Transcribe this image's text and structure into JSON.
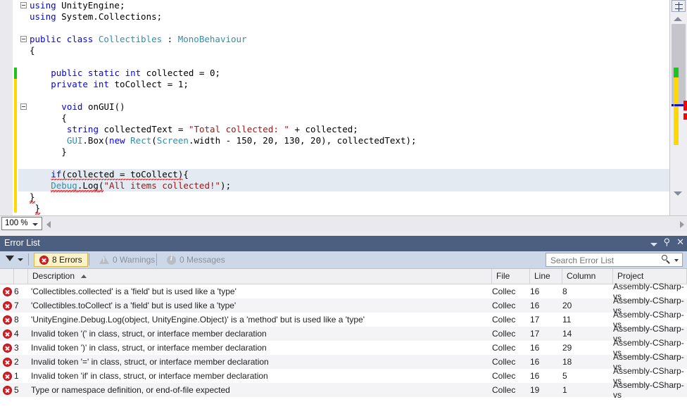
{
  "editor": {
    "zoom_level": "100 %",
    "code_lines": [
      {
        "indent": 0,
        "outline": true,
        "tokens": [
          {
            "t": "using ",
            "c": "k"
          },
          {
            "t": "UnityEngine;",
            "c": "p"
          }
        ]
      },
      {
        "indent": 0,
        "outline": false,
        "tokens": [
          {
            "t": "using ",
            "c": "k"
          },
          {
            "t": "System.Collections;",
            "c": "p"
          }
        ]
      },
      {
        "indent": 0,
        "outline": false,
        "tokens": []
      },
      {
        "indent": 0,
        "outline": true,
        "tokens": [
          {
            "t": "public ",
            "c": "k"
          },
          {
            "t": "class ",
            "c": "k"
          },
          {
            "t": "Collectibles",
            "c": "t"
          },
          {
            "t": " : ",
            "c": "p"
          },
          {
            "t": "MonoBehaviour",
            "c": "t"
          }
        ]
      },
      {
        "indent": 0,
        "outline": false,
        "tokens": [
          {
            "t": "{",
            "c": "p"
          }
        ]
      },
      {
        "indent": 0,
        "outline": false,
        "tokens": []
      },
      {
        "indent": 4,
        "outline": false,
        "tokens": [
          {
            "t": "public ",
            "c": "k"
          },
          {
            "t": "static ",
            "c": "k"
          },
          {
            "t": "int ",
            "c": "k"
          },
          {
            "t": "collected = ",
            "c": "p"
          },
          {
            "t": "0",
            "c": "p"
          },
          {
            "t": ";",
            "c": "p"
          }
        ]
      },
      {
        "indent": 4,
        "outline": false,
        "tokens": [
          {
            "t": "private ",
            "c": "k"
          },
          {
            "t": "int ",
            "c": "k"
          },
          {
            "t": "toCollect = ",
            "c": "p"
          },
          {
            "t": "1",
            "c": "p"
          },
          {
            "t": ";",
            "c": "p"
          }
        ]
      },
      {
        "indent": 0,
        "outline": false,
        "tokens": []
      },
      {
        "indent": 6,
        "outline": true,
        "tokens": [
          {
            "t": "void ",
            "c": "k"
          },
          {
            "t": "onGUI()",
            "c": "p"
          }
        ]
      },
      {
        "indent": 6,
        "outline": false,
        "tokens": [
          {
            "t": "{",
            "c": "p"
          }
        ]
      },
      {
        "indent": 6,
        "outline": false,
        "tokens": [
          {
            "t": " ",
            "c": "p"
          },
          {
            "t": "string ",
            "c": "k"
          },
          {
            "t": "collectedText = ",
            "c": "p"
          },
          {
            "t": "\"Total collected: \"",
            "c": "s"
          },
          {
            "t": " + collected;",
            "c": "p"
          }
        ]
      },
      {
        "indent": 6,
        "outline": false,
        "tokens": [
          {
            "t": " ",
            "c": "p"
          },
          {
            "t": "GUI",
            "c": "t"
          },
          {
            "t": ".Box(",
            "c": "p"
          },
          {
            "t": "new ",
            "c": "k"
          },
          {
            "t": "Rect",
            "c": "t"
          },
          {
            "t": "(",
            "c": "p"
          },
          {
            "t": "Screen",
            "c": "t"
          },
          {
            "t": ".width - 150, 20, 130, 20), collectedText);",
            "c": "p"
          }
        ]
      },
      {
        "indent": 6,
        "outline": false,
        "tokens": [
          {
            "t": "}",
            "c": "p"
          }
        ]
      },
      {
        "indent": 0,
        "outline": false,
        "tokens": []
      },
      {
        "indent": 4,
        "outline": false,
        "selected": true,
        "tokens": [
          {
            "t": "if",
            "c": "k",
            "squiggle": true
          },
          {
            "t": "(collected ",
            "c": "p",
            "squiggle": true
          },
          {
            "t": "=",
            "c": "p",
            "squiggle": true
          },
          {
            "t": " toCollect)",
            "c": "p",
            "squiggle": true
          },
          {
            "t": "{",
            "c": "p"
          }
        ]
      },
      {
        "indent": 4,
        "outline": false,
        "selected": true,
        "tokens": [
          {
            "t": "Debug",
            "c": "t",
            "squiggle": true
          },
          {
            "t": ".Log",
            "c": "p",
            "squiggle": true
          },
          {
            "t": "(",
            "c": "p",
            "squiggle": true
          },
          {
            "t": "\"All items collected!\"",
            "c": "s"
          },
          {
            "t": ");",
            "c": "p"
          }
        ]
      },
      {
        "indent": 0,
        "outline": false,
        "tokens": [
          {
            "t": "}",
            "c": "p",
            "squiggle": true
          }
        ]
      },
      {
        "indent": 1,
        "outline": false,
        "tokens": [
          {
            "t": "}",
            "c": "p",
            "squiggle": true
          }
        ]
      }
    ],
    "scrollbar": {
      "saved_change_color": "#1ec31e",
      "unsaved_change_color": "#ffd800",
      "error_marker_color": "#ff0000",
      "caret_marker_color": "#000080"
    }
  },
  "error_list": {
    "title": "Error List",
    "window_buttons": {
      "dropdown": "▾",
      "pin": "⚲",
      "close": "✕"
    },
    "filter_label": "filter-dropdown",
    "counters": [
      {
        "name": "errors",
        "label": "8 Errors",
        "icon": "error-icon",
        "active": true
      },
      {
        "name": "warnings",
        "label": "0 Warnings",
        "icon": "warning-icon",
        "active": false
      },
      {
        "name": "messages",
        "label": "0 Messages",
        "icon": "info-icon",
        "active": false
      }
    ],
    "search": {
      "placeholder": "Search Error List",
      "value": ""
    },
    "columns": [
      "",
      "",
      "Description",
      "File",
      "Line",
      "Column",
      "Project"
    ],
    "sorted_by": "Description",
    "sort_direction": "ascending",
    "rows": [
      {
        "num": "6",
        "desc": "'Collectibles.collected' is a 'field' but is used like a 'type'",
        "file": "Collec",
        "line": "16",
        "column": "8",
        "project": "Assembly-CSharp-vs"
      },
      {
        "num": "7",
        "desc": "'Collectibles.toCollect' is a 'field' but is used like a 'type'",
        "file": "Collec",
        "line": "16",
        "column": "20",
        "project": "Assembly-CSharp-vs"
      },
      {
        "num": "8",
        "desc": "'UnityEngine.Debug.Log(object, UnityEngine.Object)' is a 'method' but is used like a 'type'",
        "file": "Collec",
        "line": "17",
        "column": "11",
        "project": "Assembly-CSharp-vs"
      },
      {
        "num": "4",
        "desc": "Invalid token '(' in class, struct, or interface member declaration",
        "file": "Collec",
        "line": "17",
        "column": "14",
        "project": "Assembly-CSharp-vs"
      },
      {
        "num": "3",
        "desc": "Invalid token ')' in class, struct, or interface member declaration",
        "file": "Collec",
        "line": "16",
        "column": "29",
        "project": "Assembly-CSharp-vs"
      },
      {
        "num": "2",
        "desc": "Invalid token '=' in class, struct, or interface member declaration",
        "file": "Collec",
        "line": "16",
        "column": "18",
        "project": "Assembly-CSharp-vs"
      },
      {
        "num": "1",
        "desc": "Invalid token 'if' in class, struct, or interface member declaration",
        "file": "Collec",
        "line": "16",
        "column": "5",
        "project": "Assembly-CSharp-vs"
      },
      {
        "num": "5",
        "desc": "Type or namespace definition, or end-of-file expected",
        "file": "Collec",
        "line": "19",
        "column": "1",
        "project": "Assembly-CSharp-vs"
      }
    ]
  }
}
